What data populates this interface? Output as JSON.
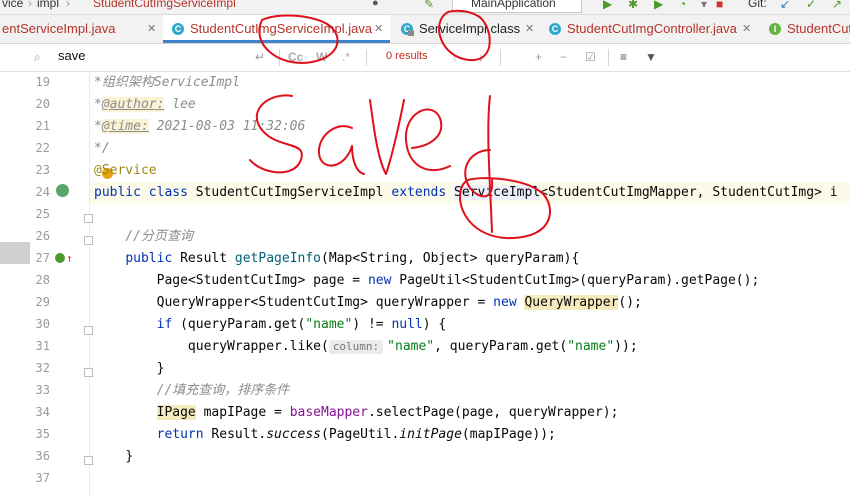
{
  "breadcrumb": {
    "items": [
      "vice",
      "impl",
      "StudentCutImgServiceImpl"
    ]
  },
  "run_config": {
    "label": "MainApplication"
  },
  "git": {
    "label": "Git:"
  },
  "tabs": [
    {
      "label": "entServiceImpl.java"
    },
    {
      "label": "StudentCutImgServiceImpl.java"
    },
    {
      "label": "ServiceImpl.class"
    },
    {
      "label": "StudentCutImgController.java"
    },
    {
      "label": "StudentCut"
    }
  ],
  "search": {
    "query": "save",
    "results": "0 results",
    "match_case": "Cc",
    "words": "W",
    "regex": ".*"
  },
  "editor": {
    "line_numbers": [
      "19",
      "20",
      "21",
      "22",
      "23",
      "24",
      "25",
      "26",
      "27",
      "28",
      "29",
      "30",
      "31",
      "32",
      "33",
      "34",
      "35",
      "36",
      "37"
    ],
    "lines": {
      "l19": "*组织架构ServiceImpl",
      "l20_tag": "@author:",
      "l20_text": " lee",
      "l21_tag": "@time:",
      "l21_text": " 2021-08-03 11:32:06",
      "l22": "*/",
      "l23": "@Service",
      "l24_kw1": "public class",
      "l24_name": " StudentCutImgServiceImpl ",
      "l24_kw2": "extends",
      "l24_super": "ServiceImpl",
      "l24_rest": "<StudentCutImgMapper, StudentCutImg> i",
      "l26": "//分页查询",
      "l27_kw": "public",
      "l27_type": " Result ",
      "l27_fn": "getPageInfo",
      "l27_rest": "(Map<String, Object> queryParam){",
      "l28_a": "Page<StudentCutImg> page = ",
      "l28_kw": "new",
      "l28_b": " PageUtil<StudentCutImg>(queryParam).getPage();",
      "l29_a": "QueryWrapper<StudentCutImg> queryWrapper = ",
      "l29_kw": "new",
      "l29_warn": "QueryWrapper",
      "l29_b": "();",
      "l30_kw": "if",
      "l30_a": " (queryParam.get(",
      "l30_str": "\"name\"",
      "l30_b": ") != ",
      "l30_null": "null",
      "l30_c": ") {",
      "l31_a": "queryWrapper.like(",
      "l31_hint": "column:",
      "l31_str": "\"name\"",
      "l31_b": ", queryParam.get(",
      "l31_str2": "\"name\"",
      "l31_c": "));",
      "l32": "}",
      "l33": "//填充查询，排序条件",
      "l34_warn": "IPage",
      "l34_a": " mapIPage = ",
      "l34_field": "baseMapper",
      "l34_b": ".selectPage(page, queryWrapper);",
      "l35_kw": "return",
      "l35_a": " Result.",
      "l35_it": "success",
      "l35_b": "(PageUtil.",
      "l35_it2": "initPage",
      "l35_c": "(mapIPage));",
      "l36": "}"
    }
  },
  "colors": {
    "annotation_ink": "#e0101a",
    "keyword": "#0033b3",
    "string": "#067d17",
    "active_tab_underline": "#4083c9"
  }
}
